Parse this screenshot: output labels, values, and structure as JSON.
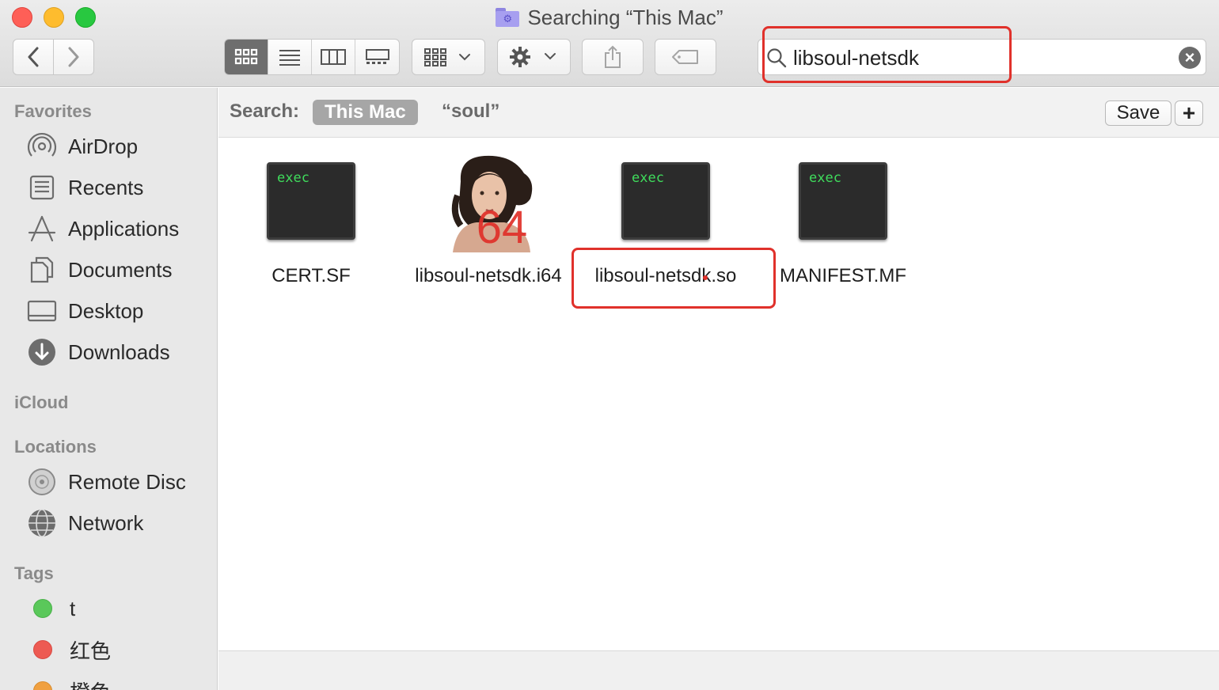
{
  "window": {
    "title": "Searching “This Mac”"
  },
  "toolbar": {
    "search_value": "libsoul-netsdk",
    "back_icon": "chevron-left-icon",
    "forward_icon": "chevron-right-icon"
  },
  "sidebar": {
    "favorites_heading": "Favorites",
    "favorites": [
      {
        "label": "AirDrop",
        "icon": "airdrop-icon"
      },
      {
        "label": "Recents",
        "icon": "recents-icon"
      },
      {
        "label": "Applications",
        "icon": "applications-icon"
      },
      {
        "label": "Documents",
        "icon": "documents-icon"
      },
      {
        "label": "Desktop",
        "icon": "desktop-icon"
      },
      {
        "label": "Downloads",
        "icon": "downloads-icon"
      }
    ],
    "icloud_heading": "iCloud",
    "locations_heading": "Locations",
    "locations": [
      {
        "label": "Remote Disc",
        "icon": "disc-icon"
      },
      {
        "label": "Network",
        "icon": "network-icon"
      }
    ],
    "tags_heading": "Tags",
    "tags": [
      {
        "label": "t",
        "color": "#5ac85a"
      },
      {
        "label": "红色",
        "color": "#ed5a52"
      },
      {
        "label": "橙色",
        "color": "#f0a040"
      }
    ]
  },
  "scope": {
    "label": "Search:",
    "active": "This Mac",
    "other": "“soul”",
    "save_label": "Save",
    "add_label": "+"
  },
  "files": [
    {
      "name": "CERT.SF",
      "icon_text": "exec",
      "kind": "exec"
    },
    {
      "name": "libsoul-netsdk.i64",
      "kind": "portrait",
      "overlay": "64"
    },
    {
      "name": "libsoul-netsdk.so",
      "icon_text": "exec",
      "kind": "exec"
    },
    {
      "name": "MANIFEST.MF",
      "icon_text": "exec",
      "kind": "exec"
    }
  ],
  "colors": {
    "annotation": "#e0312b",
    "exec_text": "#3fdc5c"
  }
}
